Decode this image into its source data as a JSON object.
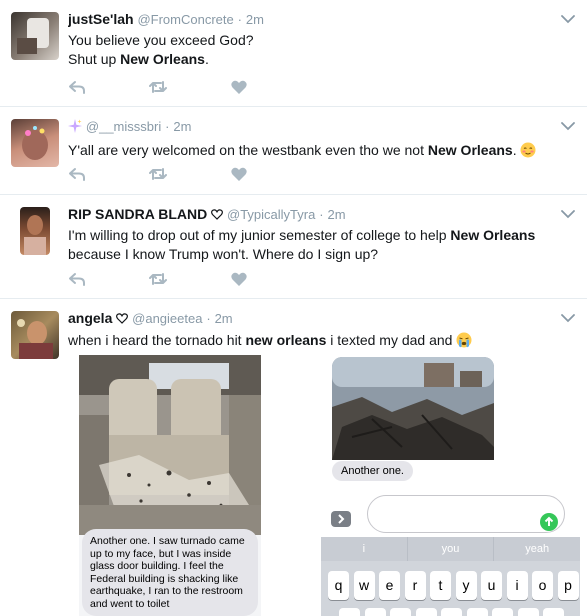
{
  "tweets": [
    {
      "name": "justSe'lah",
      "handle": "@FromConcrete",
      "time": "2m",
      "line1": "You believe you exceed God?",
      "line2_pre": "Shut up ",
      "line2_bold": "New Orleans",
      "line2_post": "."
    },
    {
      "name": "",
      "handle": "@__misssbri",
      "time": "2m",
      "text_pre": "Y'all are very welcomed on the westbank even tho we not ",
      "text_bold": "New Orleans",
      "text_post": ". "
    },
    {
      "name": "RIP SANDRA BLAND",
      "handle": "@TypicallyTyra",
      "time": "2m",
      "line1_pre": "I'm willing to drop out of my junior semester of college to help ",
      "line1_bold": "New Orleans",
      "line2": "because I know Trump won't. Where do I sign up?"
    },
    {
      "name": "angela",
      "handle": "@angieetea",
      "time": "2m",
      "text_pre": "when i heard the tornado hit ",
      "text_bold": "new orleans",
      "text_post": " i texted my dad and "
    }
  ],
  "separator": "·",
  "media": {
    "left_bubble": "Another one. I saw turnado came up to my face, but I was inside glass door building. I feel the Federal building is shacking like earthquake, I ran to the restroom and went to toilet",
    "right_bubble": "Another one.",
    "suggestions": [
      "i",
      "you",
      "yeah"
    ],
    "keys": [
      "q",
      "w",
      "e",
      "r",
      "t",
      "y",
      "u",
      "i",
      "o",
      "p"
    ]
  },
  "icons": [
    "reply-icon",
    "retweet-icon",
    "like-icon",
    "chevron-down-icon",
    "heart-outline-icon",
    "sparkles-icon",
    "blush-emoji-icon",
    "crying-emoji-icon",
    "send-arrow-icon",
    "expand-icon"
  ],
  "colors": {
    "muted": "#8899a6",
    "action": "#aab8c2",
    "text": "#14171a",
    "send": "#35c759"
  }
}
